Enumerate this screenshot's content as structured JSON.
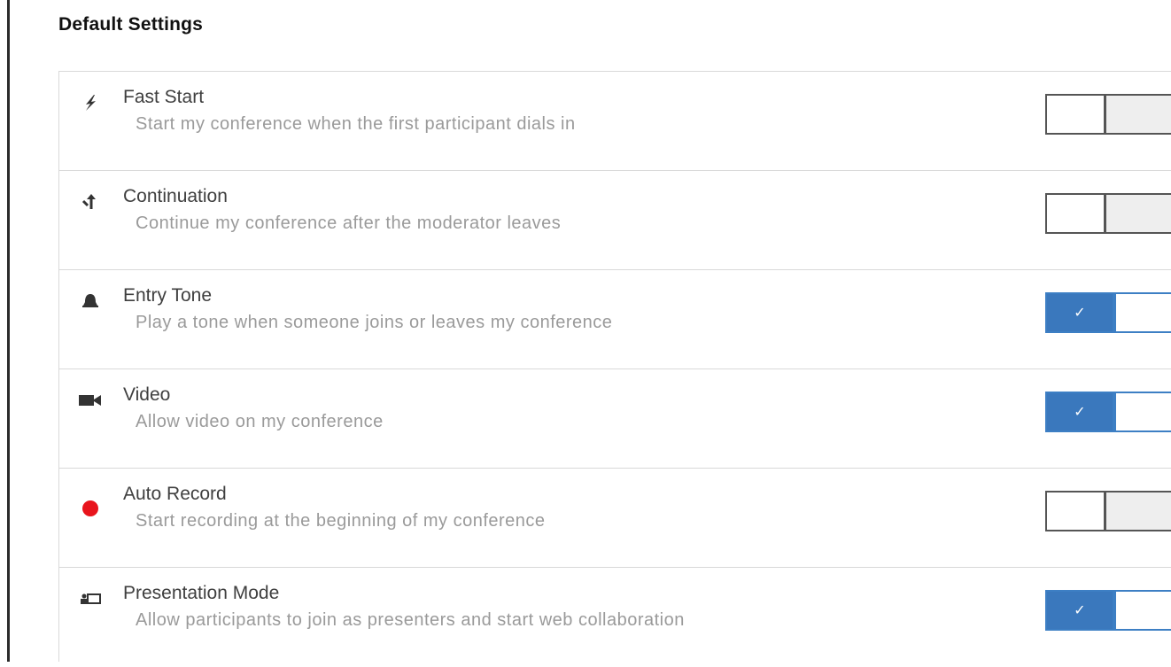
{
  "section_title": "Default Settings",
  "settings": [
    {
      "icon": "lightning-icon",
      "title": "Fast Start",
      "description": "Start my conference when the first participant dials in",
      "enabled": false
    },
    {
      "icon": "continuation-arrows-icon",
      "title": "Continuation",
      "description": "Continue my conference after the moderator leaves",
      "enabled": false
    },
    {
      "icon": "bell-icon",
      "title": "Entry Tone",
      "description": "Play a tone when someone joins or leaves my conference",
      "enabled": true
    },
    {
      "icon": "video-camera-icon",
      "title": "Video",
      "description": "Allow video on my conference",
      "enabled": true
    },
    {
      "icon": "record-dot-icon",
      "title": "Auto Record",
      "description": "Start recording at the beginning of my conference",
      "enabled": false
    },
    {
      "icon": "presentation-icon",
      "title": "Presentation Mode",
      "description": "Allow participants to join as presenters and start web collaboration",
      "enabled": true
    }
  ],
  "colors": {
    "toggle_on": "#3a78bd",
    "toggle_off_border": "#555555",
    "record_red": "#e8141c",
    "title_text": "#3f3f3f",
    "description_text": "#9a9a9a"
  }
}
